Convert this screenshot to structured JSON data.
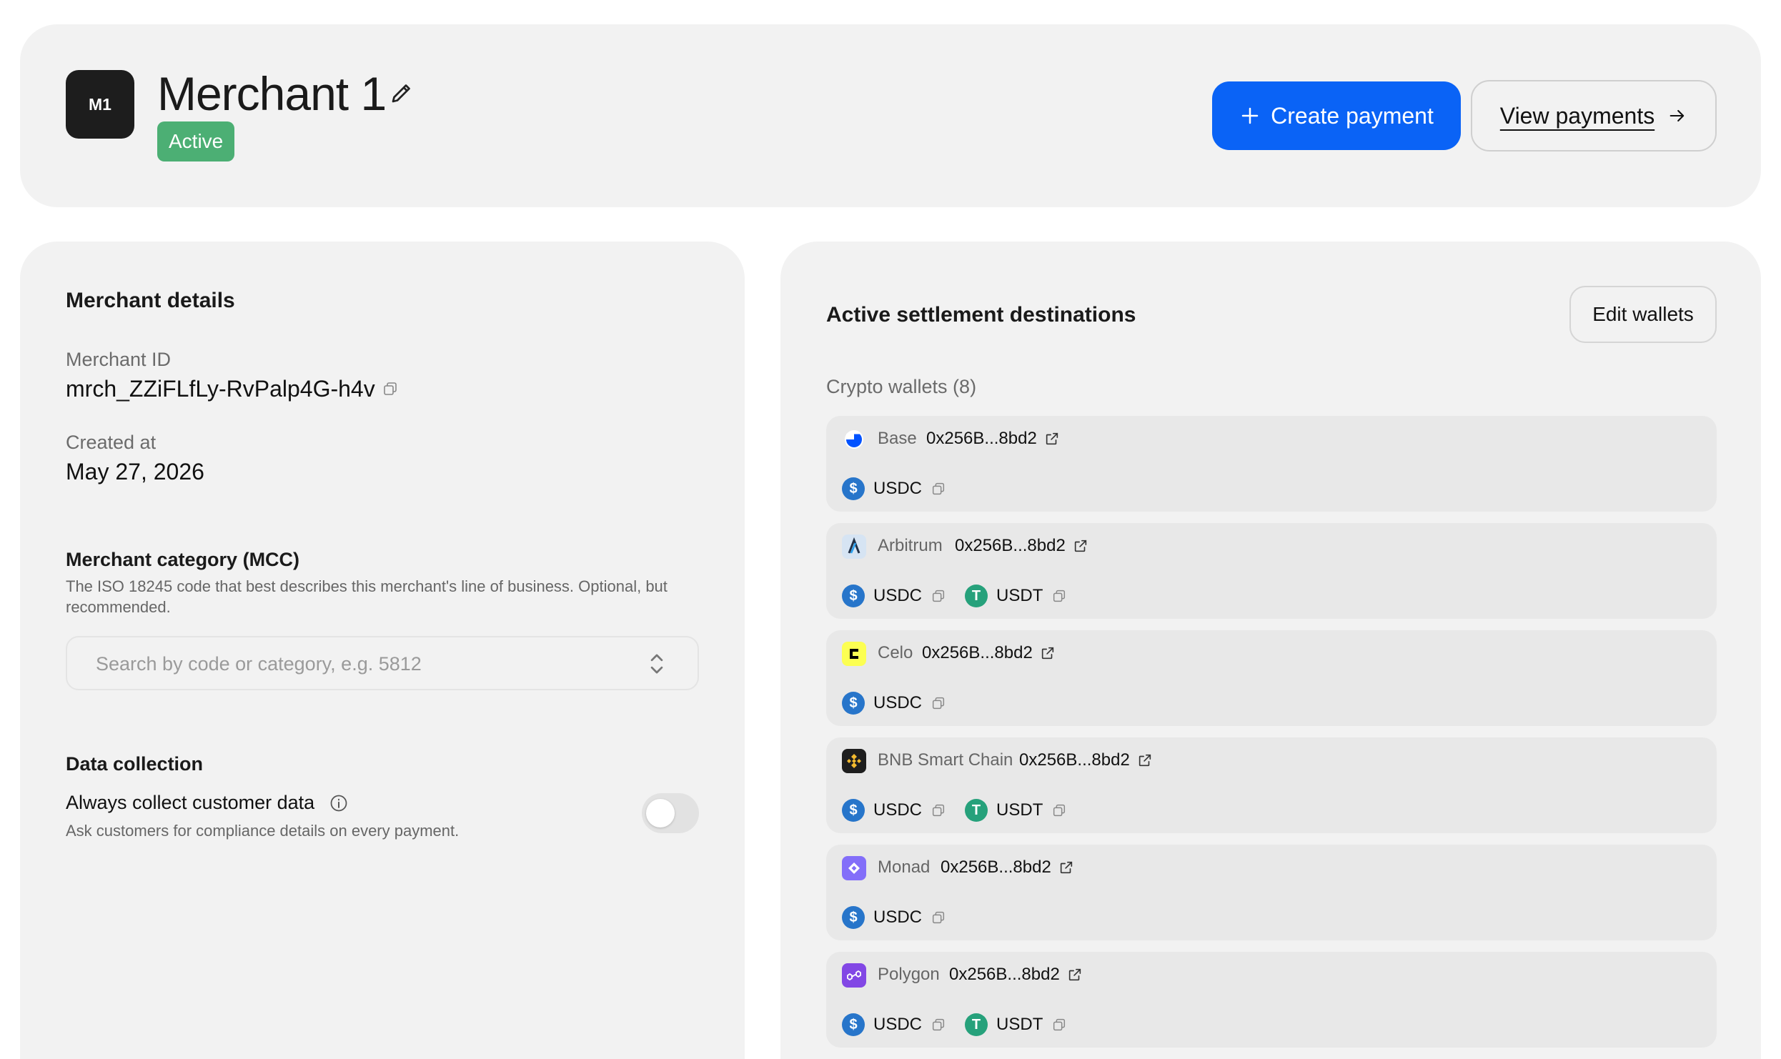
{
  "header": {
    "avatar_initials": "M1",
    "merchant_name": "Merchant 1",
    "status": "Active",
    "create_payment_label": "Create payment",
    "view_payments_label": "View payments"
  },
  "details": {
    "title": "Merchant details",
    "merchant_id_label": "Merchant ID",
    "merchant_id_value": "mrch_ZZiFLfLy-RvPalp4G-h4v",
    "created_label": "Created at",
    "created_value": "May 27, 2026",
    "mcc_title": "Merchant category (MCC)",
    "mcc_description": "The ISO 18245 code that best describes this merchant's line of business. Optional, but recommended.",
    "mcc_placeholder": "Search by code or category, e.g. 5812",
    "data_collection_title": "Data collection",
    "collect_label": "Always collect customer data",
    "collect_description": "Ask customers for compliance details on every payment.",
    "collect_enabled": false
  },
  "wallets": {
    "title": "Active settlement destinations",
    "edit_label": "Edit wallets",
    "subtitle": "Crypto wallets (8)",
    "items": [
      {
        "chain": "Base",
        "address": "0x256B...8bd2",
        "icon": "base-icon",
        "tokens": [
          "USDC"
        ]
      },
      {
        "chain": "Arbitrum",
        "address": "0x256B...8bd2",
        "icon": "arbitrum-icon",
        "tokens": [
          "USDC",
          "USDT"
        ]
      },
      {
        "chain": "Celo",
        "address": "0x256B...8bd2",
        "icon": "celo-icon",
        "tokens": [
          "USDC"
        ]
      },
      {
        "chain": "BNB Smart Chain",
        "address": "0x256B...8bd2",
        "icon": "bnb-icon",
        "tokens": [
          "USDC",
          "USDT"
        ]
      },
      {
        "chain": "Monad",
        "address": "0x256B...8bd2",
        "icon": "monad-icon",
        "tokens": [
          "USDC"
        ]
      },
      {
        "chain": "Polygon",
        "address": "0x256B...8bd2",
        "icon": "polygon-icon",
        "tokens": [
          "USDC",
          "USDT"
        ]
      }
    ]
  },
  "colors": {
    "primary": "#0a63f6",
    "active_badge": "#4caf74",
    "usdc": "#2775ca",
    "usdt": "#26a17b"
  }
}
